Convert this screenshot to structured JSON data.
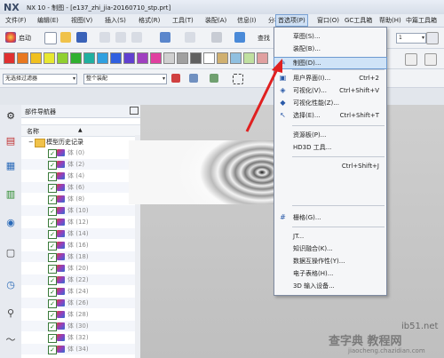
{
  "window": {
    "logo": "NX",
    "title": "NX 10 - 制图 - [e137_zhi_jia-20160710_stp.prt]"
  },
  "menubar": {
    "items": [
      "文件(F)",
      "编辑(E)",
      "视图(V)",
      "插入(S)",
      "格式(R)",
      "工具(T)",
      "装配(A)",
      "信息(I)",
      "分析(L)",
      "首选项(P)",
      "窗口(O)",
      "GC工具箱",
      "帮助(H)",
      "中篇工具箱"
    ],
    "active_index": 9
  },
  "toolbar": {
    "start_label": "启动",
    "search_label": "查找",
    "page_number": "1",
    "filter_combo": "无选择过滤器",
    "assembly_combo": "整个装配",
    "colors": [
      "#e03030",
      "#e87820",
      "#f0c020",
      "#e8e830",
      "#90d030",
      "#30b030",
      "#20b0a0",
      "#30a0e0",
      "#3060e0",
      "#6040d0",
      "#a040c0",
      "#e040a0",
      "#d0d0d0",
      "#a0a0a0",
      "#606060",
      "#ffffff",
      "#d0b070",
      "#90c0e0",
      "#c0e0a0",
      "#e0a0a0"
    ]
  },
  "navigator": {
    "title": "部件导航器",
    "column": "名称",
    "root": "模型历史记录",
    "rows": [
      "体 (0)",
      "体 (2)",
      "体 (4)",
      "体 (6)",
      "体 (8)",
      "体 (10)",
      "体 (12)",
      "体 (14)",
      "体 (16)",
      "体 (18)",
      "体 (20)",
      "体 (22)",
      "体 (24)",
      "体 (26)",
      "体 (28)",
      "体 (30)",
      "体 (32)",
      "体 (34)"
    ]
  },
  "dropdown": {
    "items": [
      {
        "label": "草图(S)...",
        "shortcut": "",
        "icon": ""
      },
      {
        "label": "装配(B)...",
        "shortcut": "",
        "icon": ""
      },
      {
        "label": "制图(D)...",
        "shortcut": "",
        "icon": "drafting-icon",
        "highlighted": true
      },
      {
        "label": "用户界面(I)...",
        "shortcut": "Ctrl+2",
        "icon": "ui-icon"
      },
      {
        "label": "可视化(V)...",
        "shortcut": "Ctrl+Shift+V",
        "icon": "visual-icon"
      },
      {
        "label": "可视化性能(Z)...",
        "shortcut": "",
        "icon": "perf-icon"
      },
      {
        "label": "选择(E)...",
        "shortcut": "Ctrl+Shift+T",
        "icon": "select-icon"
      },
      {
        "label": "资源板(P)...",
        "shortcut": "",
        "icon": ""
      },
      {
        "label": "HD3D 工具...",
        "shortcut": "",
        "icon": ""
      },
      {
        "label": "",
        "shortcut": "Ctrl+Shift+J",
        "icon": ""
      },
      {
        "label": "栅格(G)...",
        "shortcut": "",
        "icon": "grid-icon"
      },
      {
        "label": "JT...",
        "shortcut": "",
        "icon": ""
      },
      {
        "label": "知识融合(K)...",
        "shortcut": "",
        "icon": ""
      },
      {
        "label": "数据互操作性(Y)...",
        "shortcut": "",
        "icon": ""
      },
      {
        "label": "电子表格(H)...",
        "shortcut": "",
        "icon": ""
      },
      {
        "label": "3D 输入设备...",
        "shortcut": "",
        "icon": ""
      }
    ]
  },
  "watermark": {
    "site": "ib51.net",
    "brand": "查字典 教程网",
    "url": "jiaocheng.chazidian.com"
  }
}
